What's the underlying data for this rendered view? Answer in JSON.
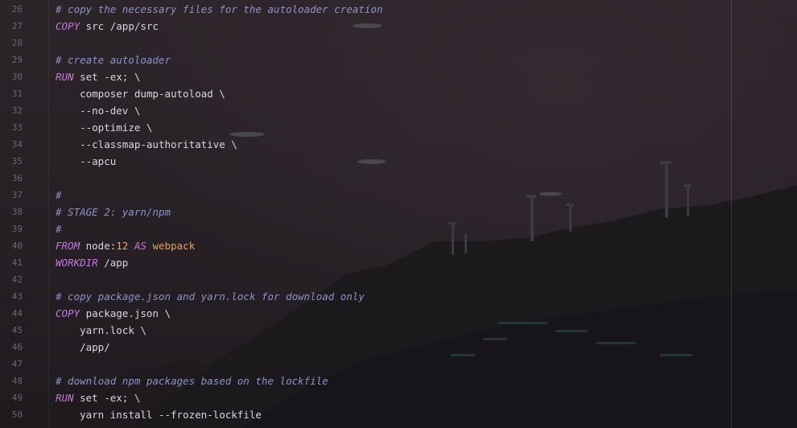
{
  "editor": {
    "lines": [
      {
        "number": "26",
        "indent": "",
        "tokens": [
          {
            "type": "comment",
            "text": "# copy the necessary files for the autoloader creation"
          }
        ]
      },
      {
        "number": "27",
        "indent": "",
        "tokens": [
          {
            "type": "kw",
            "text": "COPY"
          },
          {
            "type": "plain",
            "text": " src /app/src"
          }
        ]
      },
      {
        "number": "28",
        "indent": "",
        "tokens": []
      },
      {
        "number": "29",
        "indent": "",
        "tokens": [
          {
            "type": "comment",
            "text": "# create autoloader"
          }
        ]
      },
      {
        "number": "30",
        "indent": "",
        "tokens": [
          {
            "type": "kw",
            "text": "RUN"
          },
          {
            "type": "plain",
            "text": " set -ex; \\"
          }
        ]
      },
      {
        "number": "31",
        "indent": "    ",
        "tokens": [
          {
            "type": "plain",
            "text": "composer dump-autoload \\"
          }
        ]
      },
      {
        "number": "32",
        "indent": "    ",
        "tokens": [
          {
            "type": "plain",
            "text": "--no-dev \\"
          }
        ]
      },
      {
        "number": "33",
        "indent": "    ",
        "tokens": [
          {
            "type": "plain",
            "text": "--optimize \\"
          }
        ]
      },
      {
        "number": "34",
        "indent": "    ",
        "tokens": [
          {
            "type": "plain",
            "text": "--classmap-authoritative \\"
          }
        ]
      },
      {
        "number": "35",
        "indent": "    ",
        "tokens": [
          {
            "type": "plain",
            "text": "--apcu"
          }
        ]
      },
      {
        "number": "36",
        "indent": "",
        "tokens": []
      },
      {
        "number": "37",
        "indent": "",
        "tokens": [
          {
            "type": "comment",
            "text": "#"
          }
        ]
      },
      {
        "number": "38",
        "indent": "",
        "tokens": [
          {
            "type": "comment",
            "text": "# STAGE 2: yarn/npm"
          }
        ]
      },
      {
        "number": "39",
        "indent": "",
        "tokens": [
          {
            "type": "comment",
            "text": "#"
          }
        ]
      },
      {
        "number": "40",
        "indent": "",
        "tokens": [
          {
            "type": "kw",
            "text": "FROM"
          },
          {
            "type": "plain",
            "text": " node:"
          },
          {
            "type": "num",
            "text": "12"
          },
          {
            "type": "plain",
            "text": " "
          },
          {
            "type": "kw",
            "text": "AS"
          },
          {
            "type": "plain",
            "text": " "
          },
          {
            "type": "str",
            "text": "webpack"
          }
        ]
      },
      {
        "number": "41",
        "indent": "",
        "tokens": [
          {
            "type": "kw",
            "text": "WORKDIR"
          },
          {
            "type": "plain",
            "text": " /app"
          }
        ]
      },
      {
        "number": "42",
        "indent": "",
        "tokens": []
      },
      {
        "number": "43",
        "indent": "",
        "tokens": [
          {
            "type": "comment",
            "text": "# copy package.json and yarn.lock for download only"
          }
        ]
      },
      {
        "number": "44",
        "indent": "",
        "tokens": [
          {
            "type": "kw",
            "text": "COPY"
          },
          {
            "type": "plain",
            "text": " package.json \\"
          }
        ]
      },
      {
        "number": "45",
        "indent": "    ",
        "tokens": [
          {
            "type": "plain",
            "text": "yarn.lock \\"
          }
        ]
      },
      {
        "number": "46",
        "indent": "    ",
        "tokens": [
          {
            "type": "plain",
            "text": "/app/"
          }
        ]
      },
      {
        "number": "47",
        "indent": "",
        "tokens": []
      },
      {
        "number": "48",
        "indent": "",
        "tokens": [
          {
            "type": "comment",
            "text": "# download npm packages based on the lockfile"
          }
        ]
      },
      {
        "number": "49",
        "indent": "",
        "tokens": [
          {
            "type": "kw",
            "text": "RUN"
          },
          {
            "type": "plain",
            "text": " set -ex; \\"
          }
        ]
      },
      {
        "number": "50",
        "indent": "    ",
        "tokens": [
          {
            "type": "plain",
            "text": "yarn install --frozen-lockfile"
          }
        ]
      }
    ]
  },
  "colors": {
    "comment": "#8b93c8",
    "keyword": "#c678dd",
    "number": "#e5a061",
    "text": "#d8d6dc",
    "line_number": "#6a6670"
  }
}
